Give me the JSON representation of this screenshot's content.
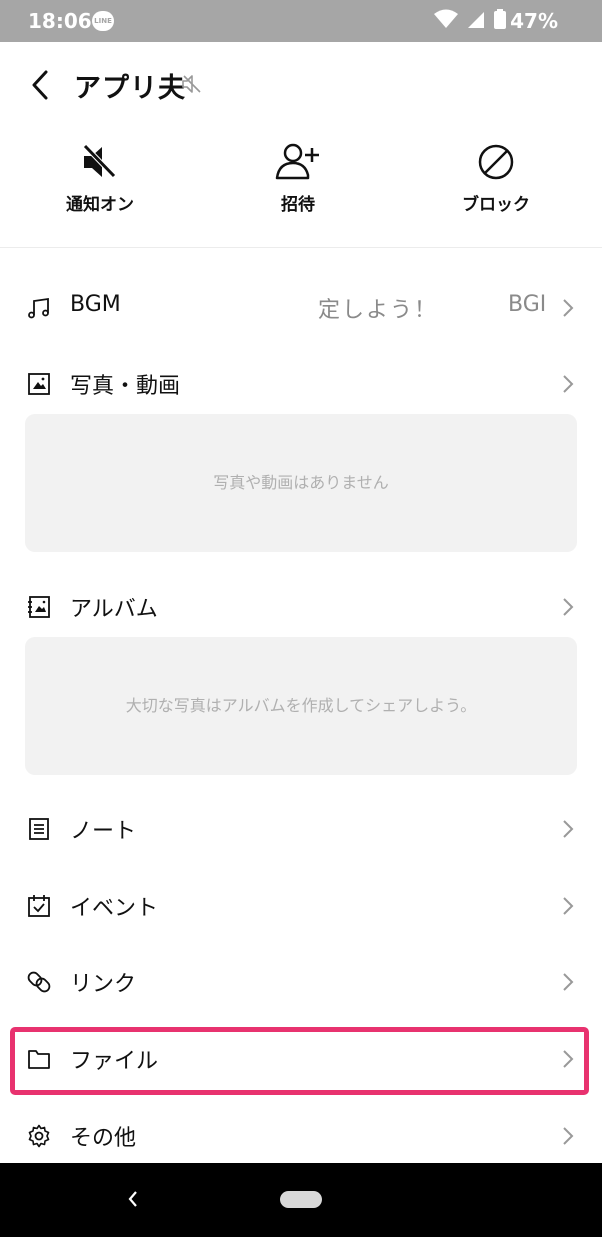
{
  "status": {
    "time": "18:06",
    "line_badge": "LINE",
    "battery_pct": "47%"
  },
  "header": {
    "title": "アプリ夫"
  },
  "actions": [
    {
      "label": "通知オン",
      "icon": "mute-icon"
    },
    {
      "label": "招待",
      "icon": "add-person-icon"
    },
    {
      "label": "ブロック",
      "icon": "block-icon"
    }
  ],
  "rows": {
    "bgm": {
      "label": "BGM",
      "preview": "定しよう！",
      "preview_tail": "BGI"
    },
    "photos": {
      "label": "写真・動画",
      "empty_text": "写真や動画はありません"
    },
    "album": {
      "label": "アルバム",
      "empty_text": "大切な写真はアルバムを作成してシェアしよう。"
    },
    "note": {
      "label": "ノート"
    },
    "event": {
      "label": "イベント"
    },
    "link": {
      "label": "リンク"
    },
    "file": {
      "label": "ファイル"
    },
    "other": {
      "label": "その他"
    }
  },
  "colors": {
    "highlight": "#e8326f",
    "statusbar": "#a6a6a6",
    "empty_bg": "#f2f2f2"
  }
}
